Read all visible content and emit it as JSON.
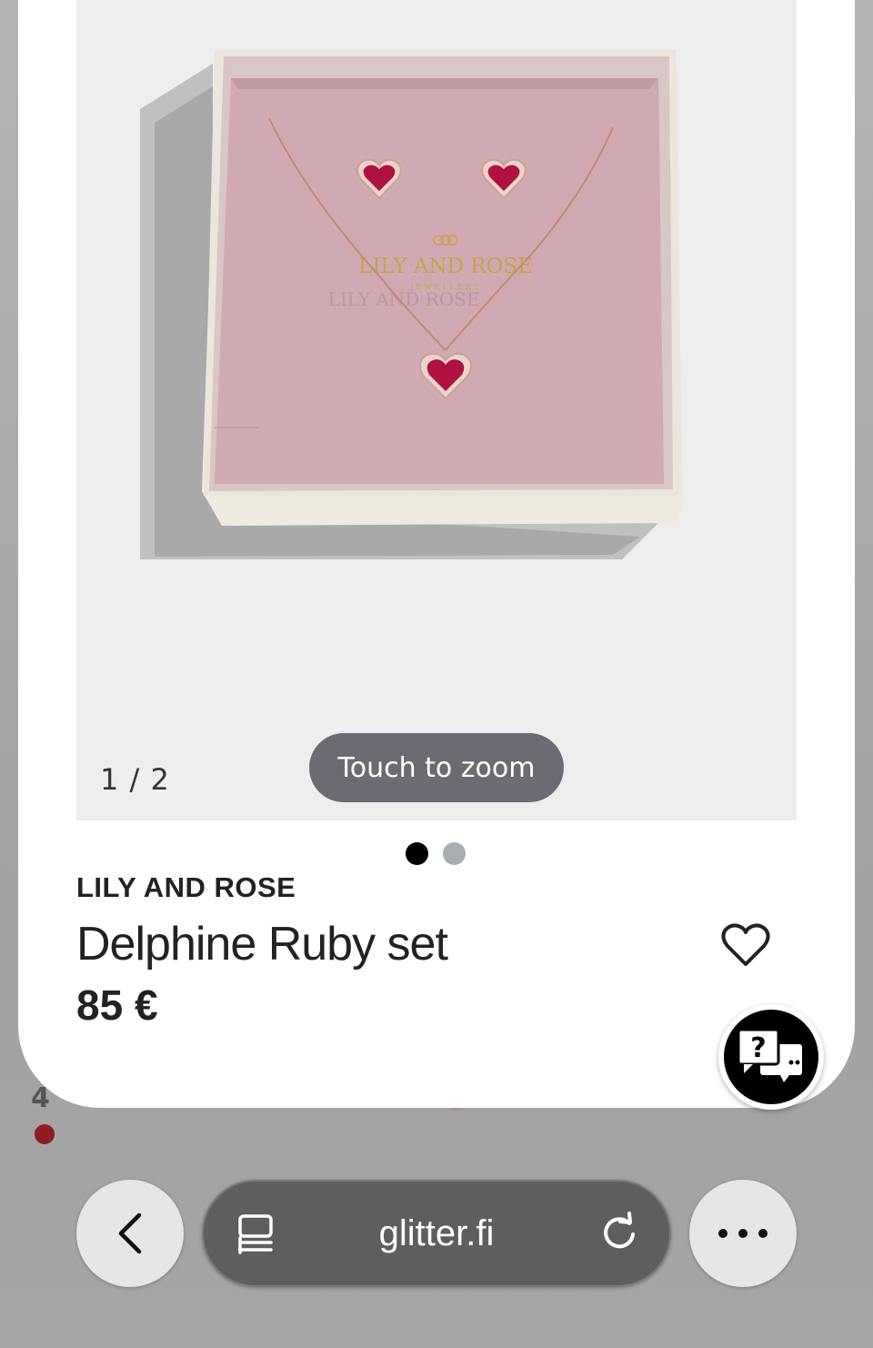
{
  "gallery": {
    "counter": "1 / 2",
    "zoom_label": "Touch to zoom",
    "slides_total": 2,
    "active_slide": 1,
    "box_brand_text": "LILY AND ROSE",
    "box_sub_text": "JEWELLERY"
  },
  "product": {
    "brand": "LILY AND ROSE",
    "name": "Delphine Ruby set",
    "price": "85 €"
  },
  "browser": {
    "url": "glitter.fi"
  },
  "background": {
    "partial_text": "4"
  },
  "icons": {
    "favorite": "heart-outline-icon",
    "chat": "chat-help-icon",
    "back": "chevron-left-icon",
    "reader": "reader-mode-icon",
    "reload": "reload-icon",
    "more": "more-dots-icon"
  },
  "colors": {
    "box_lining": "#cfaab2",
    "ruby": "#b0123f",
    "pill": "#6b6c73",
    "urlbar": "#5e5e5e"
  }
}
